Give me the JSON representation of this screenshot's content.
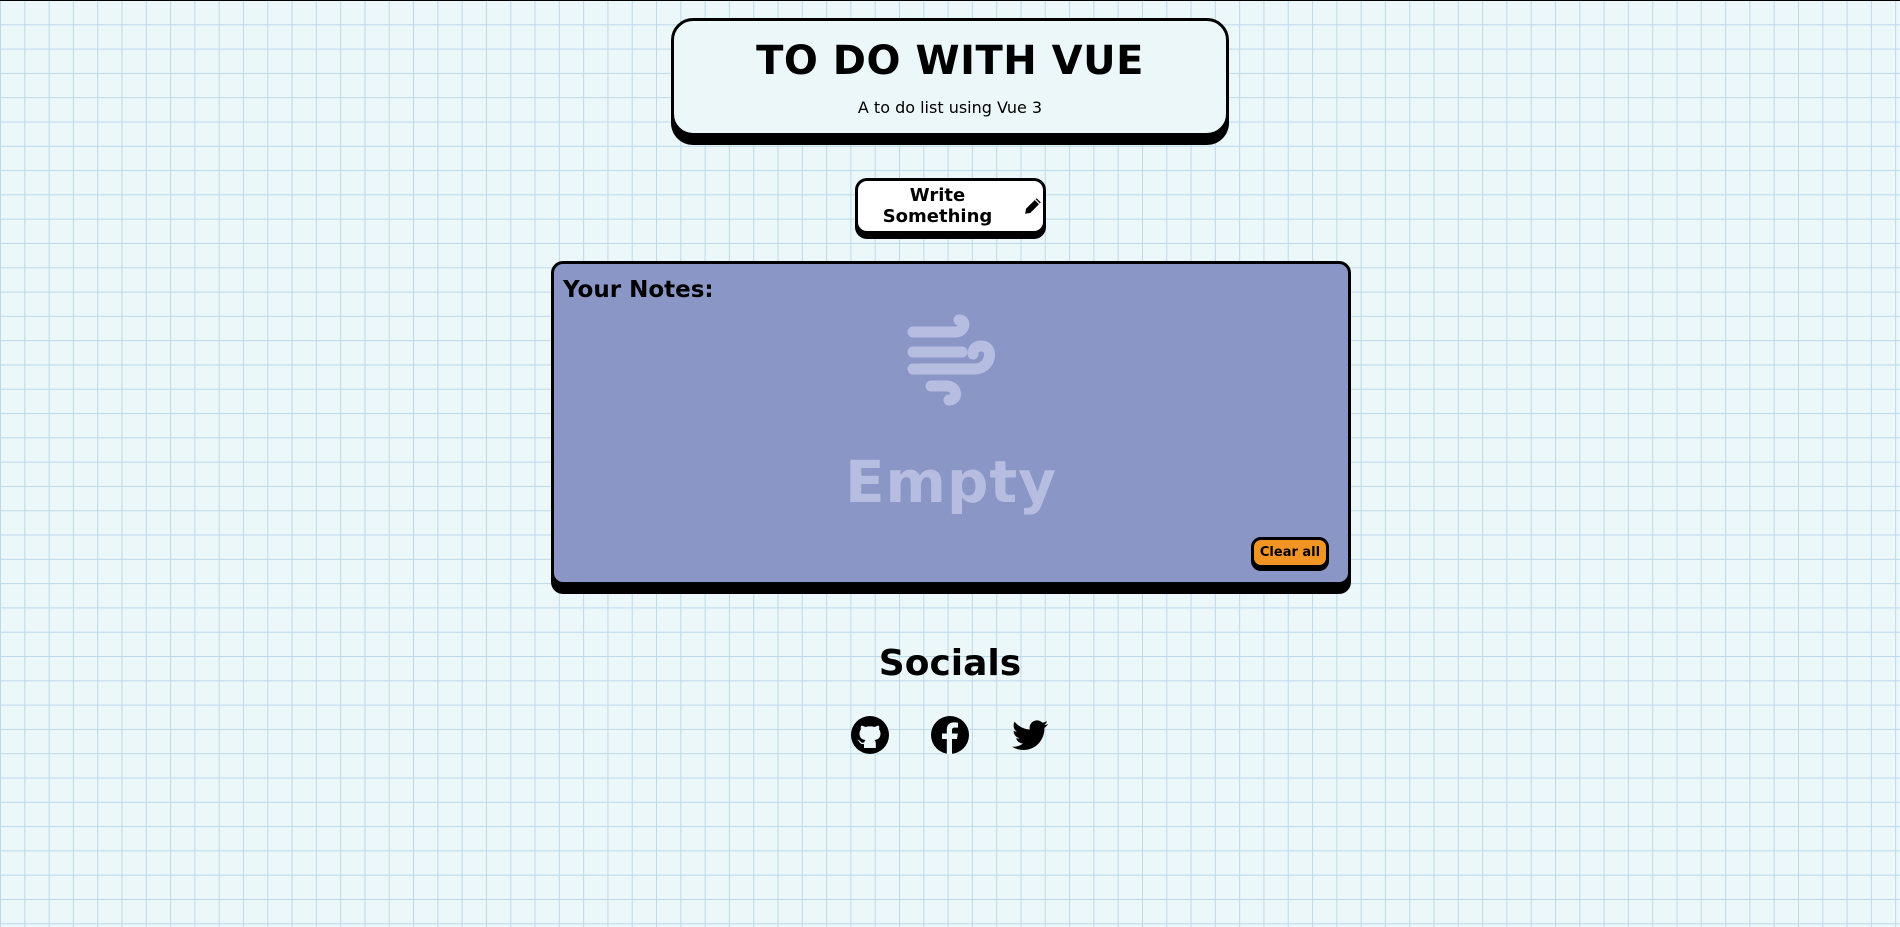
{
  "header": {
    "title": "TO DO WITH VUE",
    "subtitle": "A to do list using Vue 3"
  },
  "write_button": {
    "label": "Write Something",
    "icon": "pencil-icon"
  },
  "notes": {
    "heading": "Your Notes:",
    "empty_icon": "wind-icon",
    "empty_text": "Empty",
    "clear_label": "Clear all"
  },
  "socials": {
    "title": "Socials",
    "links": [
      {
        "icon": "github-icon"
      },
      {
        "icon": "facebook-icon"
      },
      {
        "icon": "twitter-icon"
      }
    ]
  },
  "colors": {
    "background": "#ecf7fa",
    "grid_line": "#bcd9ec",
    "notes_panel": "#8a96c6",
    "empty_state": "#b7bde1",
    "clear_button": "#f29424"
  }
}
